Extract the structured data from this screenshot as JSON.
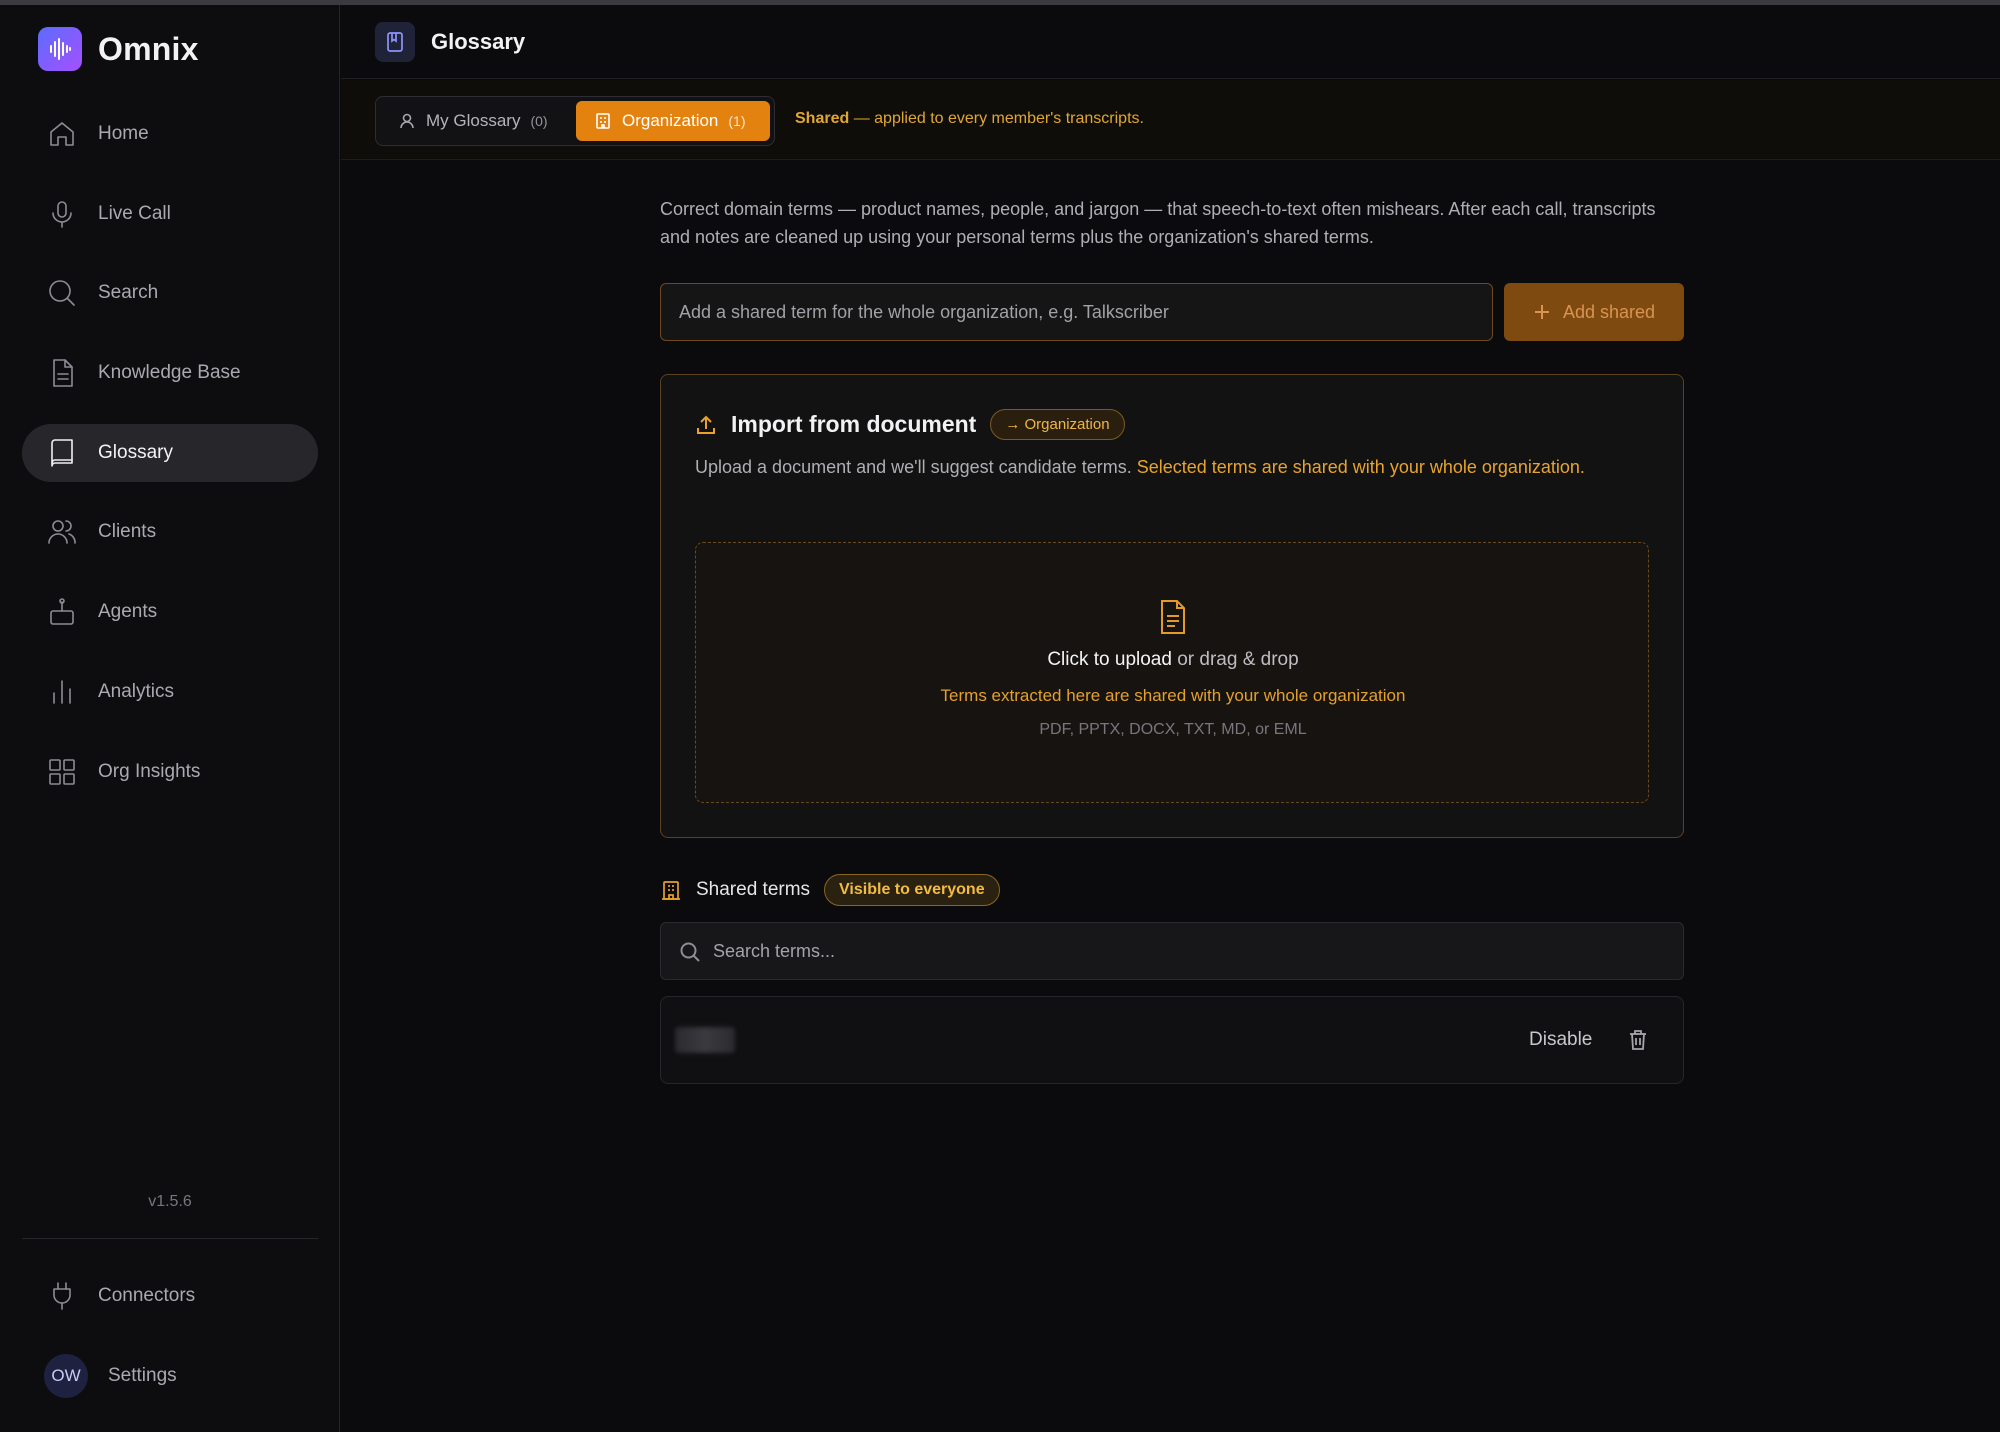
{
  "app": {
    "name": "Omnix",
    "version": "v1.5.6"
  },
  "sidebar": {
    "items": [
      {
        "label": "Home",
        "icon": "home-icon"
      },
      {
        "label": "Live Call",
        "icon": "microphone-icon"
      },
      {
        "label": "Search",
        "icon": "search-icon"
      },
      {
        "label": "Knowledge Base",
        "icon": "document-icon"
      },
      {
        "label": "Glossary",
        "icon": "book-icon",
        "active": true
      },
      {
        "label": "Clients",
        "icon": "users-icon"
      },
      {
        "label": "Agents",
        "icon": "robot-icon"
      },
      {
        "label": "Analytics",
        "icon": "bar-chart-icon"
      },
      {
        "label": "Org Insights",
        "icon": "grid-icon"
      }
    ],
    "bottom": [
      {
        "label": "Connectors",
        "icon": "plug-icon"
      },
      {
        "label": "Settings",
        "avatar": "OW"
      }
    ]
  },
  "header": {
    "title": "Glossary",
    "icon": "bookmark-book-icon"
  },
  "scope": {
    "mine_label": "My Glossary",
    "mine_count": "(0)",
    "org_label": "Organization",
    "org_count": "(1)",
    "note_bold": "Shared",
    "note_rest": " — applied to every member's transcripts."
  },
  "intro": "Correct domain terms — product names, people, and jargon — that speech-to-text often mishears. After each call, transcripts and notes are cleaned up using your personal terms plus the organization's shared terms.",
  "add": {
    "placeholder": "Add a shared term for the whole organization, e.g. Talkscriber",
    "button": "Add shared"
  },
  "import": {
    "title": "Import from document",
    "badge": "→ Organization",
    "desc_plain": "Upload a document and we'll suggest candidate terms. ",
    "desc_highlight": "Selected terms are shared with your whole organization.",
    "dz_click": "Click to upload",
    "dz_rest": " or drag & drop",
    "dz_note": "Terms extracted here are shared with your whole organization",
    "dz_formats": "PDF, PPTX, DOCX, TXT, MD, or EML"
  },
  "shared": {
    "label": "Shared terms",
    "badge": "Visible to everyone",
    "search_placeholder": "Search terms...",
    "rows": [
      {
        "term": "",
        "action": "Disable"
      }
    ]
  },
  "colors": {
    "accent": "#e4820f",
    "accent_text": "#e7a42e",
    "brand_gradient_start": "#5b6cff",
    "brand_gradient_end": "#a650ff"
  }
}
